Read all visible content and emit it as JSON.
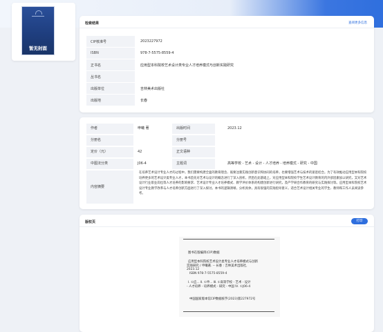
{
  "cover": {
    "title": "暂无封面"
  },
  "results": {
    "title": "检索结果",
    "more_link": "查阅更多信息",
    "rows": [
      {
        "label": "CIP核准号",
        "value": "2023227972"
      },
      {
        "label": "ISBN",
        "value": "978-7-5575-8559-4"
      },
      {
        "label": "正书名",
        "value": "应用型本科院校艺术设计类专业人才培养模式与创新实践研究"
      },
      {
        "label": "丛书名",
        "value": ""
      },
      {
        "label": "出版单位",
        "value": "吉林美术出版社"
      },
      {
        "label": "出版地",
        "value": "长春"
      }
    ]
  },
  "details": {
    "author_label": "作者",
    "author_value": "申曦  著",
    "pubdate_label": "出版时间",
    "pubdate_value": "2023.12",
    "series_label": "分册名",
    "series_value": "",
    "volno_label": "分册号",
    "volno_value": "",
    "price_label": "定价（元）",
    "price_value": "42",
    "edition_label": "正文语种",
    "edition_value": "",
    "clc_label": "中图法分类",
    "clc_value": "J06-4",
    "subject_label": "主题词",
    "subject_value": "高等学校 - 艺术 - 设计 - 人才培养 - 培养模式 - 研究 - 中国",
    "abstract_label": "内容摘要",
    "abstract_value": "在培养艺术设计专业人才的过程中，我们需要构建全面的教育理念、既要注重实践创新意识和协同的培养，也要增强艺术与技术的紧密结合。为了有效推动应用型本科院校培养更多的艺术设计类专业人才，本书首先对艺术与设计的概念进行了深入剖析，然后在此基础上，对应用型本科院校学生艺术设计教育的内外部因素加以研究，又对艺术设计行业职业岗位等人才培养的影响要求、艺术设计专业人才培养模式、教学评价体系的构建创新进行研究，及产学研合作教育的研究与实践探讨等。应用型本科院校艺术设计专业教学改革与人才培养创新方面进行了深入探讨。本书的逻辑清晰，分析具体，具有很强的实践指导意义，适合艺术设计相关专业的学生、教师和工作人员阅读参考。"
  },
  "cip": {
    "title": "版权页",
    "print_button": "打印",
    "lines": [
      "图书在版编目(CIP)数据",
      "应用型本科院校艺术设计类专业人才培养模式与创新",
      "实践研究 / 申曦著. -- 长春 : 吉林美术出版社,",
      "2023.12",
      "ISBN 978-7-5575-8559-4",
      "Ⅰ. ①应... Ⅱ. ①申... Ⅲ. ①高等学校 - 艺术 - 设计",
      "- 人才培养 - 培养模式 - 研究 - 中国 Ⅳ. ①J06-4",
      "中国国家版本馆CIP数据核字(2023)第227972号"
    ]
  },
  "colors": {
    "accent": "#2f6fde",
    "label_bg": "#f1f3f7",
    "cover_bg": "#1e3d7d"
  }
}
